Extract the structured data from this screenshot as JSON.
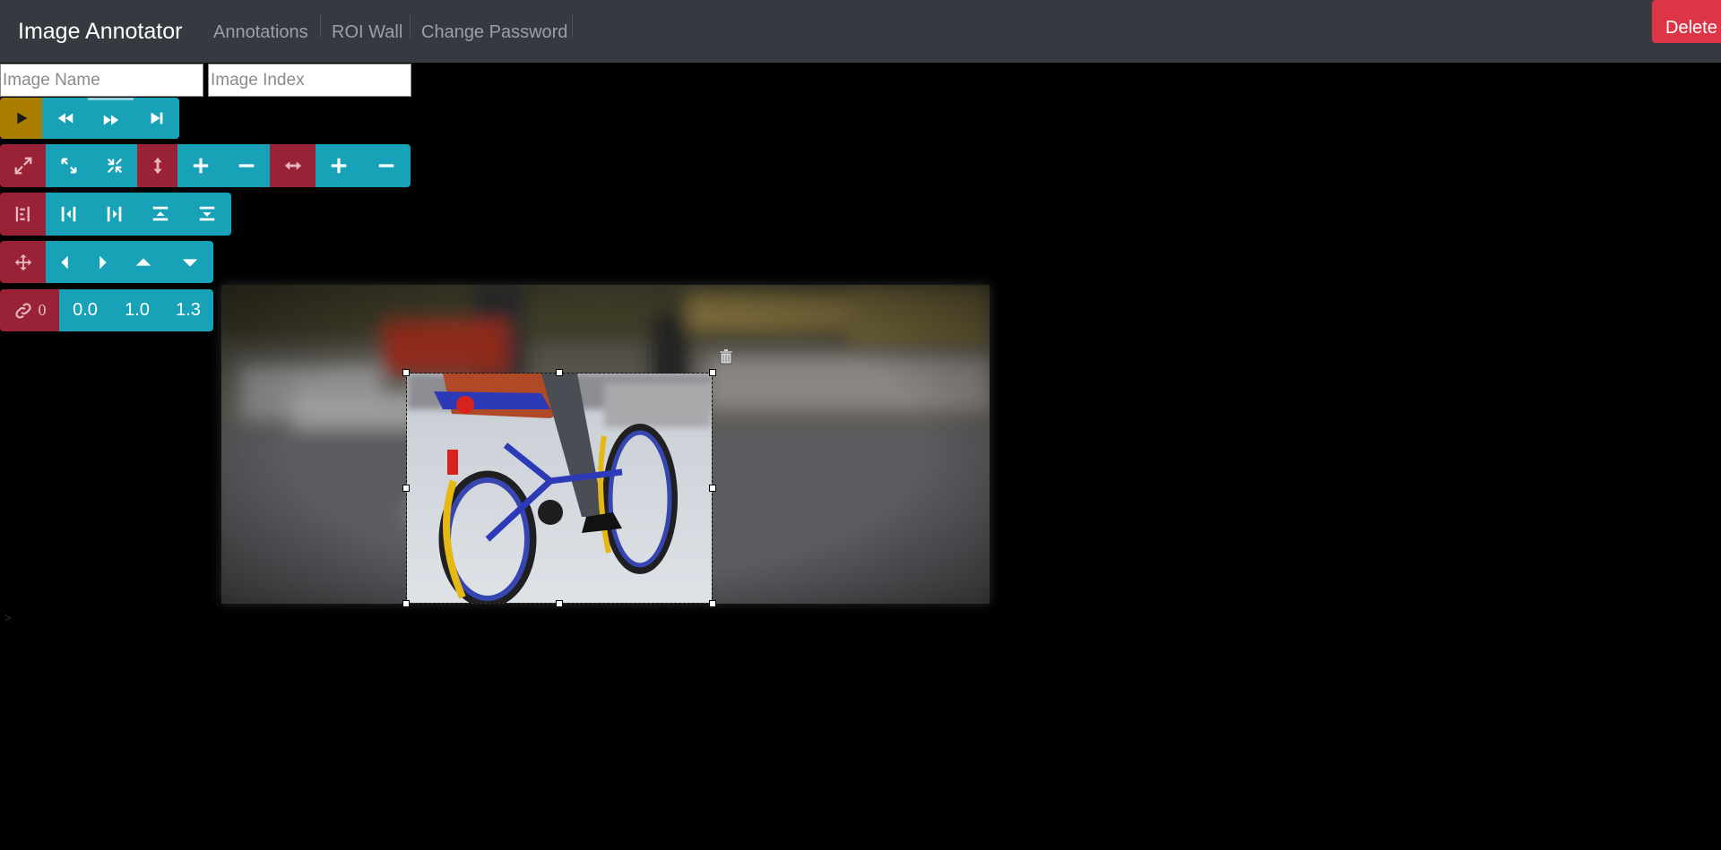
{
  "navbar": {
    "brand": "Image Annotator",
    "links": [
      "Annotations",
      "ROI Wall",
      "Change Password"
    ],
    "delete_label": "Delete"
  },
  "inputs": {
    "image_name_placeholder": "Image Name",
    "image_index_placeholder": "Image Index"
  },
  "toolbar": {
    "link_count": "0",
    "values": [
      "0.0",
      "1.0",
      "1.3"
    ]
  },
  "colors": {
    "navbar": "#343a40",
    "danger": "#dc3545",
    "info": "#17a2b8",
    "muted_red": "#9a2236",
    "gold": "#a87d00"
  },
  "caret": ">"
}
